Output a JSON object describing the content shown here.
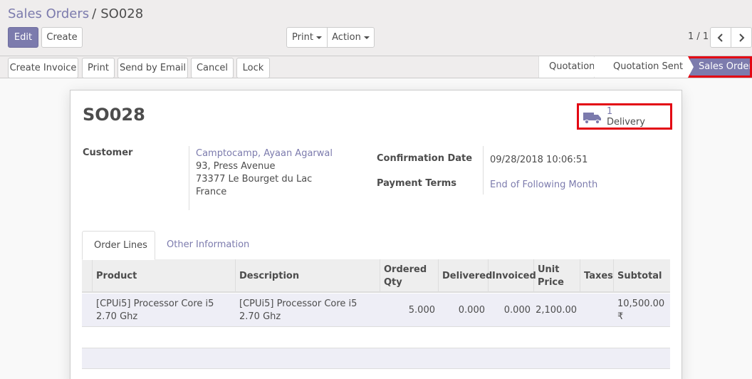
{
  "breadcrumb": {
    "parent": "Sales Orders",
    "separator": "/",
    "current": "SO028"
  },
  "toolbar": {
    "edit_label": "Edit",
    "create_label": "Create",
    "print_label": "Print",
    "action_label": "Action",
    "pager_value": "1 / 1",
    "prev_icon": "chevron-left-icon",
    "next_icon": "chevron-right-icon"
  },
  "statusbar": {
    "buttons": [
      "Create Invoice",
      "Print",
      "Send by Email",
      "Cancel",
      "Lock"
    ],
    "stages": [
      "Quotation",
      "Quotation Sent",
      "Sales Order"
    ],
    "active_stage": "Sales Order"
  },
  "record": {
    "title": "SO028",
    "smart_button": {
      "icon": "truck-icon",
      "value": "1",
      "label": "Delivery"
    },
    "customer_label": "Customer",
    "customer_name": "Camptocamp, Ayaan Agarwal",
    "address": [
      "93, Press Avenue",
      "73377 Le Bourget du Lac",
      "France"
    ],
    "confirmation_date_label": "Confirmation Date",
    "confirmation_date": "09/28/2018 10:06:51",
    "payment_terms_label": "Payment Terms",
    "payment_terms": "End of Following Month"
  },
  "tabs": [
    "Order Lines",
    "Other Information"
  ],
  "order_lines": {
    "headers": [
      "Product",
      "Description",
      "Ordered Qty",
      "Delivered",
      "Invoiced",
      "Unit Price",
      "Taxes",
      "Subtotal"
    ],
    "rows": [
      {
        "product": "[CPUi5] Processor Core i5 2.70 Ghz",
        "description": "[CPUi5] Processor Core i5 2.70 Ghz",
        "ordered_qty": "5.000",
        "delivered": "0.000",
        "invoiced": "0.000",
        "unit_price": "2,100.00",
        "taxes": "",
        "subtotal": "10,500.00 ₹"
      }
    ]
  },
  "colors": {
    "brand": "#7c7bad",
    "highlight": "#e30613"
  }
}
